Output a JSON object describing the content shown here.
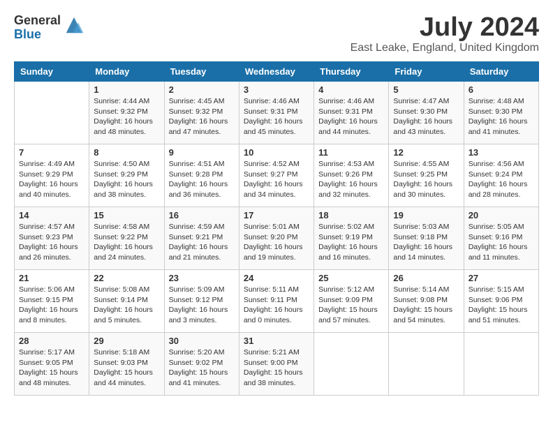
{
  "header": {
    "logo_general": "General",
    "logo_blue": "Blue",
    "month_title": "July 2024",
    "location": "East Leake, England, United Kingdom"
  },
  "days_of_week": [
    "Sunday",
    "Monday",
    "Tuesday",
    "Wednesday",
    "Thursday",
    "Friday",
    "Saturday"
  ],
  "weeks": [
    [
      {
        "day": "",
        "sunrise": "",
        "sunset": "",
        "daylight": ""
      },
      {
        "day": "1",
        "sunrise": "Sunrise: 4:44 AM",
        "sunset": "Sunset: 9:32 PM",
        "daylight": "Daylight: 16 hours and 48 minutes."
      },
      {
        "day": "2",
        "sunrise": "Sunrise: 4:45 AM",
        "sunset": "Sunset: 9:32 PM",
        "daylight": "Daylight: 16 hours and 47 minutes."
      },
      {
        "day": "3",
        "sunrise": "Sunrise: 4:46 AM",
        "sunset": "Sunset: 9:31 PM",
        "daylight": "Daylight: 16 hours and 45 minutes."
      },
      {
        "day": "4",
        "sunrise": "Sunrise: 4:46 AM",
        "sunset": "Sunset: 9:31 PM",
        "daylight": "Daylight: 16 hours and 44 minutes."
      },
      {
        "day": "5",
        "sunrise": "Sunrise: 4:47 AM",
        "sunset": "Sunset: 9:30 PM",
        "daylight": "Daylight: 16 hours and 43 minutes."
      },
      {
        "day": "6",
        "sunrise": "Sunrise: 4:48 AM",
        "sunset": "Sunset: 9:30 PM",
        "daylight": "Daylight: 16 hours and 41 minutes."
      }
    ],
    [
      {
        "day": "7",
        "sunrise": "Sunrise: 4:49 AM",
        "sunset": "Sunset: 9:29 PM",
        "daylight": "Daylight: 16 hours and 40 minutes."
      },
      {
        "day": "8",
        "sunrise": "Sunrise: 4:50 AM",
        "sunset": "Sunset: 9:29 PM",
        "daylight": "Daylight: 16 hours and 38 minutes."
      },
      {
        "day": "9",
        "sunrise": "Sunrise: 4:51 AM",
        "sunset": "Sunset: 9:28 PM",
        "daylight": "Daylight: 16 hours and 36 minutes."
      },
      {
        "day": "10",
        "sunrise": "Sunrise: 4:52 AM",
        "sunset": "Sunset: 9:27 PM",
        "daylight": "Daylight: 16 hours and 34 minutes."
      },
      {
        "day": "11",
        "sunrise": "Sunrise: 4:53 AM",
        "sunset": "Sunset: 9:26 PM",
        "daylight": "Daylight: 16 hours and 32 minutes."
      },
      {
        "day": "12",
        "sunrise": "Sunrise: 4:55 AM",
        "sunset": "Sunset: 9:25 PM",
        "daylight": "Daylight: 16 hours and 30 minutes."
      },
      {
        "day": "13",
        "sunrise": "Sunrise: 4:56 AM",
        "sunset": "Sunset: 9:24 PM",
        "daylight": "Daylight: 16 hours and 28 minutes."
      }
    ],
    [
      {
        "day": "14",
        "sunrise": "Sunrise: 4:57 AM",
        "sunset": "Sunset: 9:23 PM",
        "daylight": "Daylight: 16 hours and 26 minutes."
      },
      {
        "day": "15",
        "sunrise": "Sunrise: 4:58 AM",
        "sunset": "Sunset: 9:22 PM",
        "daylight": "Daylight: 16 hours and 24 minutes."
      },
      {
        "day": "16",
        "sunrise": "Sunrise: 4:59 AM",
        "sunset": "Sunset: 9:21 PM",
        "daylight": "Daylight: 16 hours and 21 minutes."
      },
      {
        "day": "17",
        "sunrise": "Sunrise: 5:01 AM",
        "sunset": "Sunset: 9:20 PM",
        "daylight": "Daylight: 16 hours and 19 minutes."
      },
      {
        "day": "18",
        "sunrise": "Sunrise: 5:02 AM",
        "sunset": "Sunset: 9:19 PM",
        "daylight": "Daylight: 16 hours and 16 minutes."
      },
      {
        "day": "19",
        "sunrise": "Sunrise: 5:03 AM",
        "sunset": "Sunset: 9:18 PM",
        "daylight": "Daylight: 16 hours and 14 minutes."
      },
      {
        "day": "20",
        "sunrise": "Sunrise: 5:05 AM",
        "sunset": "Sunset: 9:16 PM",
        "daylight": "Daylight: 16 hours and 11 minutes."
      }
    ],
    [
      {
        "day": "21",
        "sunrise": "Sunrise: 5:06 AM",
        "sunset": "Sunset: 9:15 PM",
        "daylight": "Daylight: 16 hours and 8 minutes."
      },
      {
        "day": "22",
        "sunrise": "Sunrise: 5:08 AM",
        "sunset": "Sunset: 9:14 PM",
        "daylight": "Daylight: 16 hours and 5 minutes."
      },
      {
        "day": "23",
        "sunrise": "Sunrise: 5:09 AM",
        "sunset": "Sunset: 9:12 PM",
        "daylight": "Daylight: 16 hours and 3 minutes."
      },
      {
        "day": "24",
        "sunrise": "Sunrise: 5:11 AM",
        "sunset": "Sunset: 9:11 PM",
        "daylight": "Daylight: 16 hours and 0 minutes."
      },
      {
        "day": "25",
        "sunrise": "Sunrise: 5:12 AM",
        "sunset": "Sunset: 9:09 PM",
        "daylight": "Daylight: 15 hours and 57 minutes."
      },
      {
        "day": "26",
        "sunrise": "Sunrise: 5:14 AM",
        "sunset": "Sunset: 9:08 PM",
        "daylight": "Daylight: 15 hours and 54 minutes."
      },
      {
        "day": "27",
        "sunrise": "Sunrise: 5:15 AM",
        "sunset": "Sunset: 9:06 PM",
        "daylight": "Daylight: 15 hours and 51 minutes."
      }
    ],
    [
      {
        "day": "28",
        "sunrise": "Sunrise: 5:17 AM",
        "sunset": "Sunset: 9:05 PM",
        "daylight": "Daylight: 15 hours and 48 minutes."
      },
      {
        "day": "29",
        "sunrise": "Sunrise: 5:18 AM",
        "sunset": "Sunset: 9:03 PM",
        "daylight": "Daylight: 15 hours and 44 minutes."
      },
      {
        "day": "30",
        "sunrise": "Sunrise: 5:20 AM",
        "sunset": "Sunset: 9:02 PM",
        "daylight": "Daylight: 15 hours and 41 minutes."
      },
      {
        "day": "31",
        "sunrise": "Sunrise: 5:21 AM",
        "sunset": "Sunset: 9:00 PM",
        "daylight": "Daylight: 15 hours and 38 minutes."
      },
      {
        "day": "",
        "sunrise": "",
        "sunset": "",
        "daylight": ""
      },
      {
        "day": "",
        "sunrise": "",
        "sunset": "",
        "daylight": ""
      },
      {
        "day": "",
        "sunrise": "",
        "sunset": "",
        "daylight": ""
      }
    ]
  ]
}
